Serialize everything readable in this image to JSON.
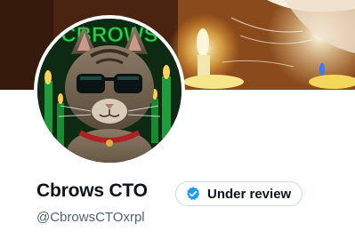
{
  "profile": {
    "display_name": "Cbrows CTO",
    "handle": "@CbrowsCTOxrpl",
    "verification_status": "Under review",
    "avatar_text": "CBROWS"
  },
  "colors": {
    "name_text": "#0f1419",
    "handle_text": "#536471",
    "badge_border": "#cfd9de",
    "verified_blue": "#1d9bf0"
  },
  "icons": {
    "verified": "verified-badge-icon"
  }
}
